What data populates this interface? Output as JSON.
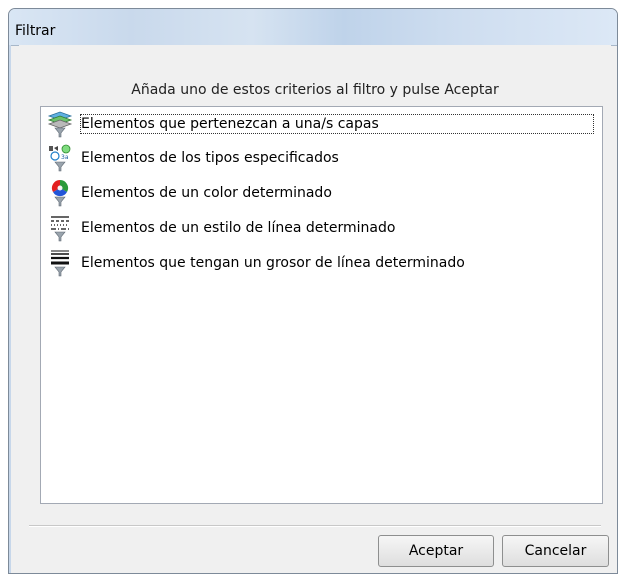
{
  "window": {
    "title": "Filtrar"
  },
  "instruction": "Añada uno de estos criterios al filtro y pulse Aceptar",
  "criteria": [
    {
      "label": "Elementos que pertenezcan a una/s capas",
      "icon": "layers-funnel-icon"
    },
    {
      "label": "Elementos de los tipos especificados",
      "icon": "element-types-funnel-icon"
    },
    {
      "label": "Elementos de un color determinado",
      "icon": "color-wheel-funnel-icon"
    },
    {
      "label": "Elementos de un estilo de línea determinado",
      "icon": "line-style-funnel-icon"
    },
    {
      "label": "Elementos que tengan un grosor de línea determinado",
      "icon": "line-weight-funnel-icon"
    }
  ],
  "buttons": {
    "ok": "Aceptar",
    "cancel": "Cancelar"
  }
}
